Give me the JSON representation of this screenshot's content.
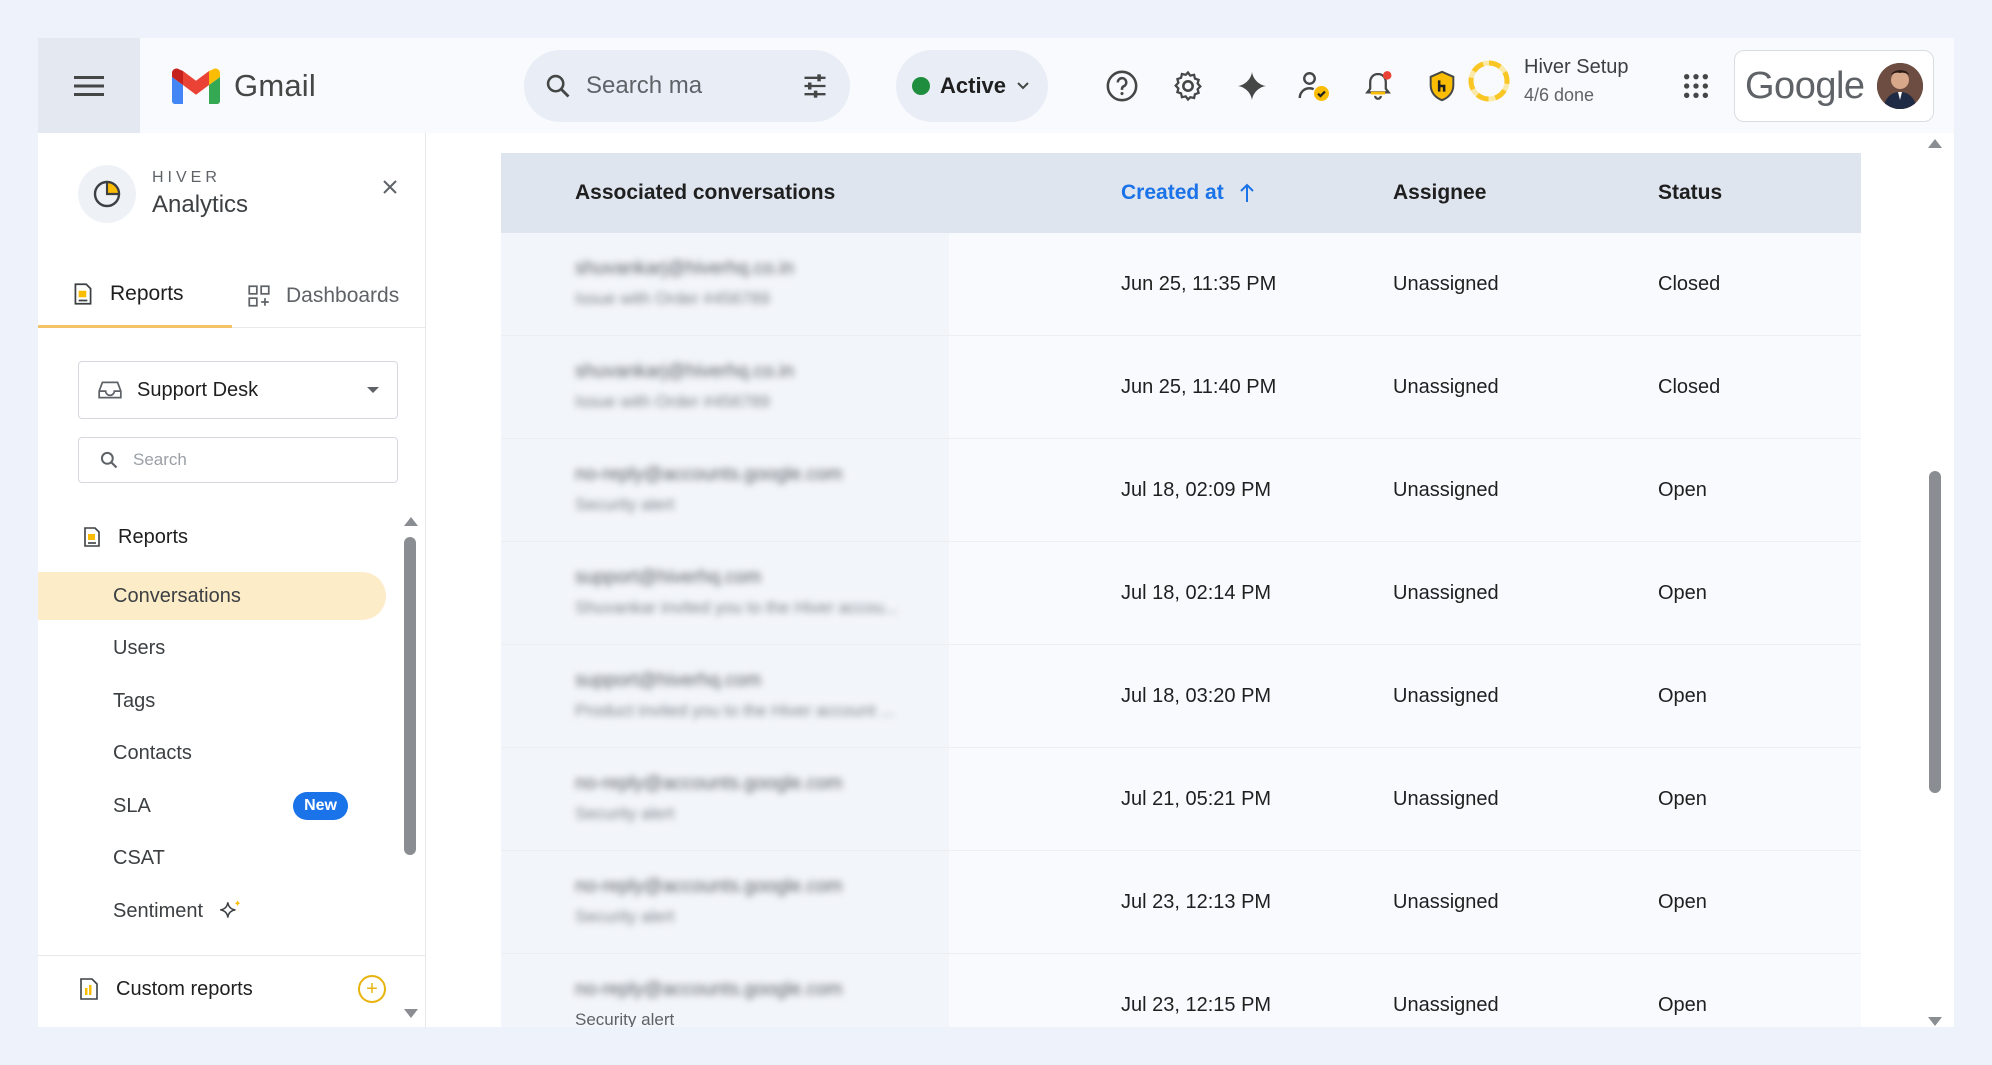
{
  "gmail": {
    "brand": "Gmail",
    "search_placeholder": "Search ma",
    "status_label": "Active",
    "setup_title": "Hiver Setup",
    "setup_progress": "4/6 done",
    "account_brand": "Google"
  },
  "sidebar": {
    "brand_small": "HIVER",
    "brand_big": "Analytics",
    "tabs": [
      {
        "label": "Reports",
        "active": true
      },
      {
        "label": "Dashboards",
        "active": false
      }
    ],
    "mailbox": "Support Desk",
    "search_placeholder": "Search",
    "section_title": "Reports",
    "items": [
      {
        "label": "Conversations",
        "active": true
      },
      {
        "label": "Users"
      },
      {
        "label": "Tags"
      },
      {
        "label": "Contacts"
      },
      {
        "label": "SLA",
        "badge": "New"
      },
      {
        "label": "CSAT"
      },
      {
        "label": "Sentiment"
      }
    ],
    "custom_reports": "Custom reports"
  },
  "table": {
    "columns": {
      "conversations": "Associated conversations",
      "created": "Created at",
      "assignee": "Assignee",
      "status": "Status"
    },
    "sort": {
      "column": "created",
      "direction": "ascending"
    },
    "rows": [
      {
        "email": "shuvankarj@hiverhq.co.in",
        "subject": "Issue with Order #456789",
        "created": "Jun 25, 11:35 PM",
        "assignee": "Unassigned",
        "status": "Closed"
      },
      {
        "email": "shuvankarj@hiverhq.co.in",
        "subject": "Issue with Order #456789",
        "created": "Jun 25, 11:40 PM",
        "assignee": "Unassigned",
        "status": "Closed"
      },
      {
        "email": "no-reply@accounts.google.com",
        "subject": "Security alert",
        "created": "Jul 18, 02:09 PM",
        "assignee": "Unassigned",
        "status": "Open"
      },
      {
        "email": "support@hiverhq.com",
        "subject": "Shuvankar invited you to the Hiver accou...",
        "created": "Jul 18, 02:14 PM",
        "assignee": "Unassigned",
        "status": "Open"
      },
      {
        "email": "support@hiverhq.com",
        "subject": "Product invited you to the Hiver account ...",
        "created": "Jul 18, 03:20 PM",
        "assignee": "Unassigned",
        "status": "Open"
      },
      {
        "email": "no-reply@accounts.google.com",
        "subject": "Security alert",
        "created": "Jul 21, 05:21 PM",
        "assignee": "Unassigned",
        "status": "Open"
      },
      {
        "email": "no-reply@accounts.google.com",
        "subject": "Security alert",
        "created": "Jul 23, 12:13 PM",
        "assignee": "Unassigned",
        "status": "Open"
      },
      {
        "email": "no-reply@accounts.google.com",
        "subject": "Security alert",
        "created": "Jul 23, 12:15 PM",
        "assignee": "Unassigned",
        "status": "Open"
      }
    ]
  },
  "colors": {
    "accent": "#1a73e8",
    "active_nav": "#fdecc8",
    "tab_underline": "#f4c269",
    "status_green": "#1e8e3e"
  },
  "icons": [
    "menu-icon",
    "gmail-logo",
    "search-icon",
    "tune-icon",
    "help-icon",
    "settings-icon",
    "gemini-icon",
    "agent-status-icon",
    "notifications-icon",
    "hiver-shield-icon",
    "progress-ring-icon",
    "apps-grid-icon",
    "avatar",
    "analytics-icon",
    "reports-icon",
    "dashboards-icon",
    "inbox-icon",
    "close-icon",
    "sparkle-icon",
    "custom-reports-icon",
    "add-icon",
    "sort-up-icon"
  ]
}
